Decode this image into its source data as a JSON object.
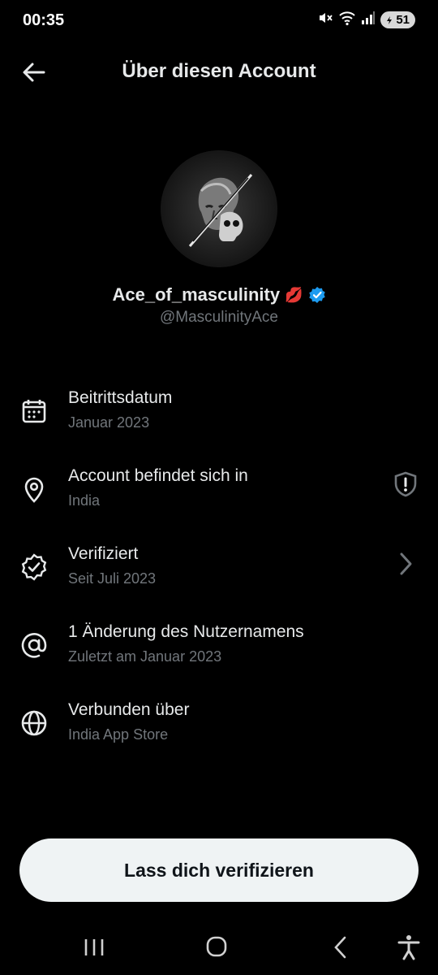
{
  "status_bar": {
    "time": "00:35",
    "battery": "51",
    "icons": [
      "mute-icon",
      "wifi-icon",
      "signal-icon",
      "battery-icon"
    ]
  },
  "header": {
    "title": "Über diesen Account",
    "back_icon": "arrow-left-icon"
  },
  "profile": {
    "display_name": "Ace_of_masculinity",
    "emoji": "💋",
    "handle": "@MasculinityAce",
    "verified_color": "#1d9bf0"
  },
  "rows": [
    {
      "icon": "calendar-icon",
      "label": "Beitrittsdatum",
      "sub": "Januar 2023"
    },
    {
      "icon": "location-pin-icon",
      "label": "Account befindet sich in",
      "sub": "India",
      "trailing_icon": "shield-alert-icon"
    },
    {
      "icon": "verified-badge-icon",
      "label": "Verifiziert",
      "sub": "Seit Juli 2023",
      "trailing_icon": "chevron-right-icon"
    },
    {
      "icon": "at-sign-icon",
      "label": "1 Änderung des Nutzernamens",
      "sub": "Zuletzt am Januar 2023"
    },
    {
      "icon": "globe-icon",
      "label": "Verbunden über",
      "sub": "India App Store"
    }
  ],
  "cta": {
    "label": "Lass dich verifizieren"
  },
  "nav_bar": {
    "icons": [
      "recents-icon",
      "home-icon",
      "back-icon",
      "accessibility-icon"
    ]
  },
  "colors": {
    "background": "#000000",
    "text": "#e7e9ea",
    "muted": "#71767b",
    "accent": "#1d9bf0",
    "button": "#eff3f4"
  }
}
